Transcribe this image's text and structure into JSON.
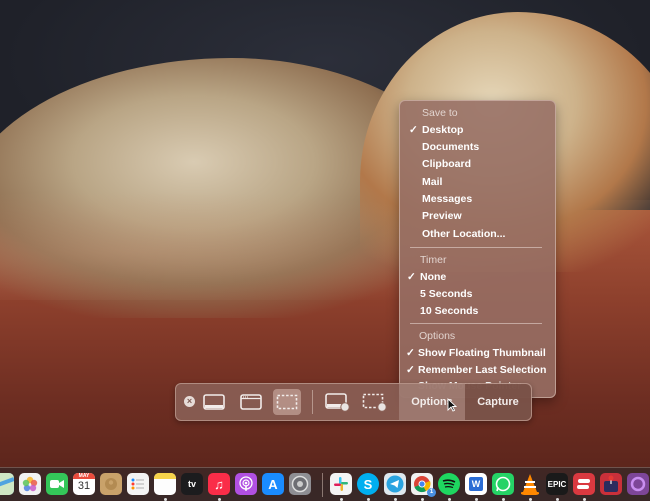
{
  "screenshot_toolbar": {
    "buttons": [
      {
        "name": "close",
        "icon": "close-icon"
      },
      {
        "name": "capture-entire-screen",
        "icon": "entire-screen-icon"
      },
      {
        "name": "capture-selected-window",
        "icon": "window-icon"
      },
      {
        "name": "capture-selected-portion",
        "icon": "selection-icon",
        "selected": true
      },
      {
        "name": "record-entire-screen",
        "icon": "record-screen-icon"
      },
      {
        "name": "record-selected-portion",
        "icon": "record-selection-icon"
      }
    ],
    "options_label": "Options",
    "capture_label": "Capture"
  },
  "options_menu": {
    "save_to": {
      "header": "Save to",
      "items": [
        {
          "label": "Desktop",
          "checked": true
        },
        {
          "label": "Documents",
          "checked": false
        },
        {
          "label": "Clipboard",
          "checked": false
        },
        {
          "label": "Mail",
          "checked": false
        },
        {
          "label": "Messages",
          "checked": false
        },
        {
          "label": "Preview",
          "checked": false
        },
        {
          "label": "Other Location...",
          "checked": false
        }
      ]
    },
    "timer": {
      "header": "Timer",
      "items": [
        {
          "label": "None",
          "checked": true
        },
        {
          "label": "5 Seconds",
          "checked": false
        },
        {
          "label": "10 Seconds",
          "checked": false
        }
      ]
    },
    "options": {
      "header": "Options",
      "items": [
        {
          "label": "Show Floating Thumbnail",
          "checked": true
        },
        {
          "label": "Remember Last Selection",
          "checked": true
        },
        {
          "label": "Show Mouse Pointer",
          "checked": false
        }
      ]
    },
    "check_glyph": "✓"
  },
  "dock": {
    "apps": [
      {
        "name": "Maps",
        "icon": "maps-icon",
        "color": "#4fa3e0"
      },
      {
        "name": "Photos",
        "icon": "photos-icon",
        "color": "#f2f2f2"
      },
      {
        "name": "FaceTime",
        "icon": "facetime-icon",
        "color": "#34c759"
      },
      {
        "name": "Calendar",
        "icon": "calendar-icon",
        "color": "#ffffff",
        "month": "MAY",
        "day": "31"
      },
      {
        "name": "Contacts",
        "icon": "contacts-icon",
        "color": "#c9a26a"
      },
      {
        "name": "Reminders",
        "icon": "reminders-icon",
        "color": "#f4f4f4"
      },
      {
        "name": "Notes",
        "icon": "notes-icon",
        "color": "#f7e27a",
        "running": true
      },
      {
        "name": "Apple TV",
        "icon": "appletv-icon",
        "color": "#1c1c1e",
        "label": "tv"
      },
      {
        "name": "Music",
        "icon": "music-icon",
        "color": "#fa2d48",
        "running": true
      },
      {
        "name": "Podcasts",
        "icon": "podcasts-icon",
        "color": "#b150e2"
      },
      {
        "name": "App Store",
        "icon": "appstore-icon",
        "color": "#1a8cff"
      },
      {
        "name": "System Preferences",
        "icon": "system-preferences-icon",
        "color": "#8e8e93"
      },
      {
        "name": "Slack",
        "icon": "slack-icon",
        "color": "#f4f4f4",
        "running": true
      },
      {
        "name": "Skype",
        "icon": "skype-icon",
        "color": "#00aff0",
        "label": "S",
        "running": true
      },
      {
        "name": "Telegram",
        "icon": "telegram-icon",
        "color": "#2aa3e0",
        "running": true
      },
      {
        "name": "Chrome",
        "icon": "chrome-icon",
        "color": "#f1f1f1",
        "badge": "1",
        "running": true
      },
      {
        "name": "Spotify",
        "icon": "spotify-icon",
        "color": "#1ed760",
        "running": true
      },
      {
        "name": "Word",
        "icon": "word-icon",
        "color": "#2b6cd4",
        "label": "W",
        "running": true
      },
      {
        "name": "WhatsApp",
        "icon": "whatsapp-icon",
        "color": "#25d366",
        "running": true
      },
      {
        "name": "VLC",
        "icon": "vlc-icon",
        "color": "#ff8800",
        "running": true
      },
      {
        "name": "Epic Games",
        "icon": "epic-games-icon",
        "color": "#1a1a1a",
        "label": "EPIC",
        "running": true
      },
      {
        "name": "ExpressVPN",
        "icon": "expressvpn-icon",
        "color": "#da3940",
        "running": true
      },
      {
        "name": "Joystick Doctor",
        "icon": "joystick-icon",
        "color": "#c9303a"
      },
      {
        "name": "Tor Browser",
        "icon": "tor-icon",
        "color": "#7d4698"
      }
    ]
  }
}
